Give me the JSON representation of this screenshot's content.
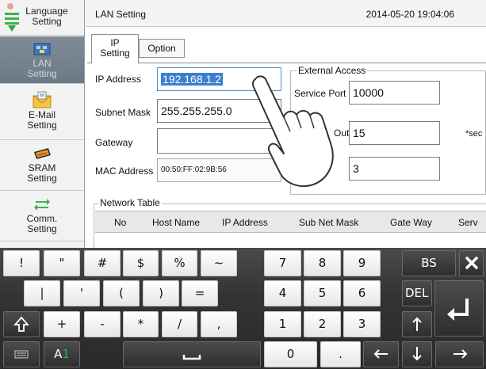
{
  "sidebar": {
    "items": [
      {
        "label": "Language Setting",
        "icon": "language-icon"
      },
      {
        "label": "LAN Setting",
        "icon": "lan-icon",
        "active": true
      },
      {
        "label": "E-Mail Setting",
        "icon": "email-icon"
      },
      {
        "label": "SRAM Setting",
        "icon": "sram-icon"
      },
      {
        "label": "Comm. Setting",
        "icon": "comm-icon"
      }
    ],
    "language_line1": "Language",
    "language_line2": "Setting",
    "lan_line1": "LAN",
    "lan_line2": "Setting",
    "email_line1": "E-Mail",
    "email_line2": "Setting",
    "sram_line1": "SRAM",
    "sram_line2": "Setting",
    "comm_line1": "Comm.",
    "comm_line2": "Setting"
  },
  "header": {
    "title": "LAN Setting",
    "datetime": "2014-05-20 19:04:06"
  },
  "tabs": {
    "ip_line1": "IP",
    "ip_line2": "Setting",
    "option": "Option"
  },
  "form": {
    "ip_label": "IP Address",
    "ip_value": "192.168.1.2",
    "subnet_label": "Subnet Mask",
    "subnet_value": "255.255.255.0",
    "gateway_label": "Gateway",
    "gateway_value": "",
    "mac_label": "MAC Address",
    "mac_value": "00:50:FF:02:9B:56"
  },
  "external_access": {
    "title": "External Access",
    "service_port_label": "Service Port",
    "service_port_value": "10000",
    "timeout_label": "Out",
    "timeout_value": "15",
    "timeout_unit": "*sec",
    "third_value": "3"
  },
  "network_table": {
    "title": "Network Table",
    "columns": [
      "No",
      "Host Name",
      "IP Address",
      "Sub Net Mask",
      "Gate Way",
      "Serv"
    ]
  },
  "keyboard": {
    "row1": [
      "!",
      "\"",
      "#",
      "$",
      "%",
      "~"
    ],
    "row2": [
      "|",
      "'",
      "(",
      ")",
      "="
    ],
    "row3": [
      "+",
      "-",
      "*",
      "/",
      ","
    ],
    "numrow1": [
      "7",
      "8",
      "9"
    ],
    "numrow2": [
      "4",
      "5",
      "6"
    ],
    "numrow3": [
      "1",
      "2",
      "3"
    ],
    "zero": "0",
    "dot": ".",
    "bs": "BS",
    "del": "DEL",
    "mode": "A1",
    "accent_color": "#29b84a"
  }
}
